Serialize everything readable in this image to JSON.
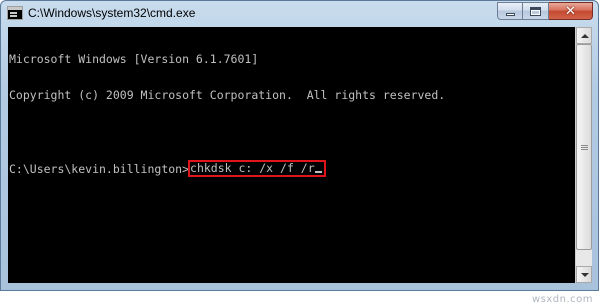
{
  "window": {
    "title": "C:\\Windows\\system32\\cmd.exe",
    "icon": "console-icon",
    "controls": {
      "minimize": "minimize-icon",
      "maximize": "maximize-icon",
      "close_glyph": "✕"
    }
  },
  "console": {
    "header_lines": [
      "Microsoft Windows [Version 6.1.7601]",
      "Copyright (c) 2009 Microsoft Corporation.  All rights reserved."
    ],
    "blank_line": "",
    "prompt": "C:\\Users\\kevin.billington>",
    "command": "chkdsk c: /x /f /r",
    "text_color": "#c0c0c0",
    "background": "#000000",
    "highlight_color": "#e0151b"
  },
  "watermark": "wsxdn.com"
}
